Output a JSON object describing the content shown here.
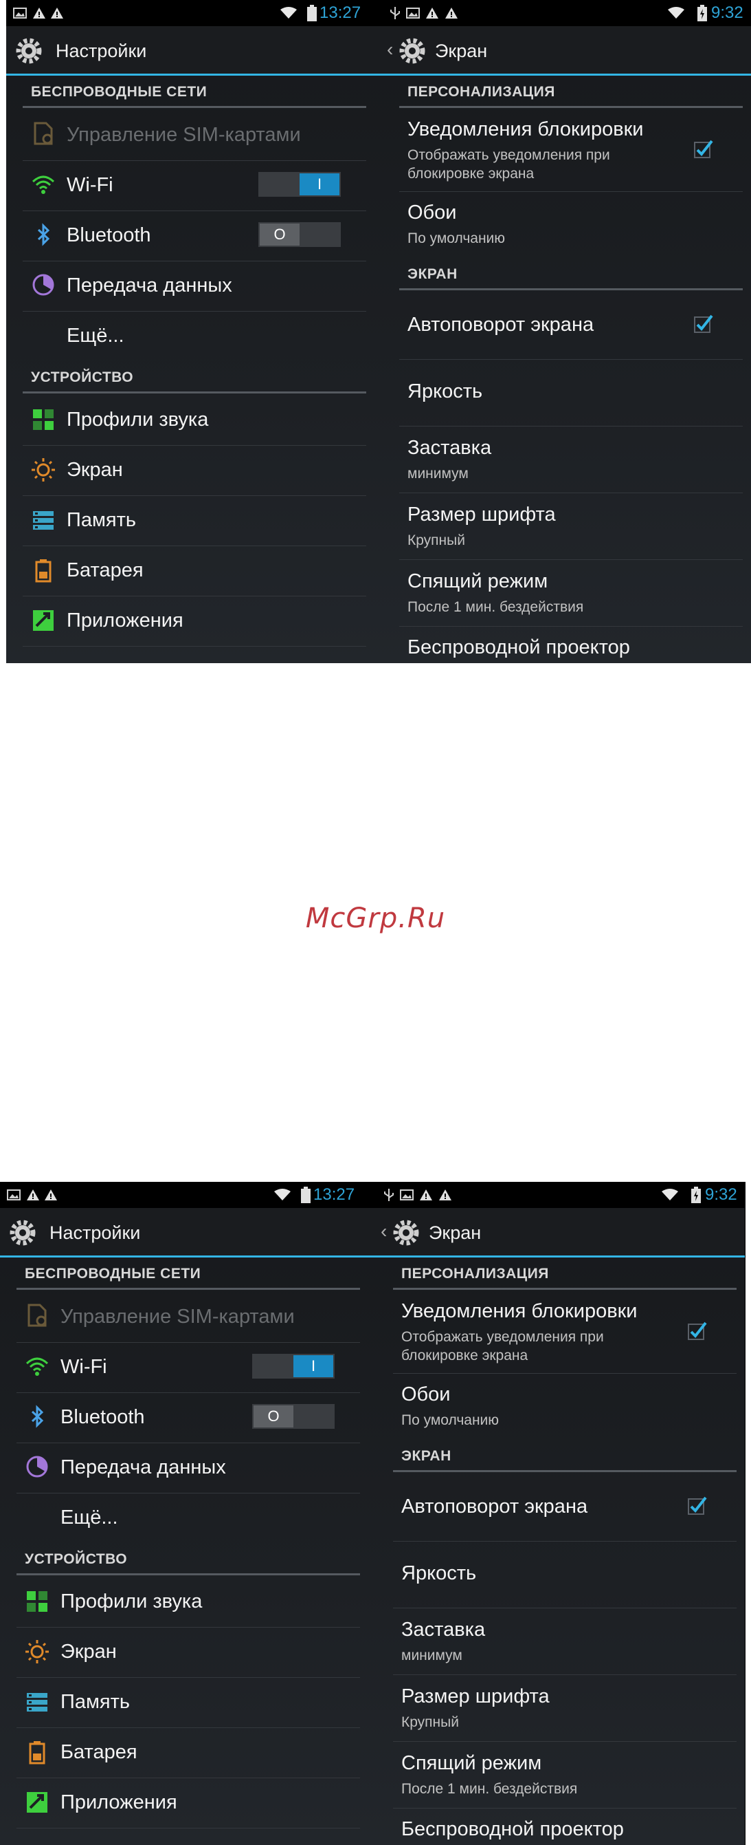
{
  "watermark": "McGrp.Ru",
  "screens": [
    {
      "left": {
        "time": "13:27",
        "title": "Настройки",
        "section_wireless": "БЕСПРОВОДНЫЕ СЕТИ",
        "sim": "Управление SIM-картами",
        "wifi": "Wi-Fi",
        "bluetooth": "Bluetooth",
        "data": "Передача данных",
        "more": "Ещё...",
        "section_device": "УСТРОЙСТВО",
        "sound": "Профили звука",
        "display": "Экран",
        "storage": "Память",
        "battery": "Батарея",
        "apps": "Приложения",
        "toggle_on_glyph": "I",
        "toggle_off_glyph": "O"
      },
      "right": {
        "time": "9:32",
        "title": "Экран",
        "section_personal": "ПЕРСОНАЛИЗАЦИЯ",
        "lock_title": "Уведомления блокировки",
        "lock_sub1": "Отображать уведомления при",
        "lock_sub2": "блокировке экрана",
        "wallpaper": "Обои",
        "wallpaper_sub": "По умолчанию",
        "section_screen": "ЭКРАН",
        "autorotate": "Автоповорот экрана",
        "brightness": "Яркость",
        "daydream": "Заставка",
        "daydream_sub": "минимум",
        "fontsize": "Размер шрифта",
        "fontsize_sub": "Крупный",
        "sleep": "Спящий режим",
        "sleep_sub": "После 1 мин. бездействия",
        "wireless_display": "Беспроводной проектор"
      }
    },
    {
      "left": {
        "time": "13:27",
        "title": "Настройки",
        "section_wireless": "БЕСПРОВОДНЫЕ СЕТИ",
        "sim": "Управление SIM-картами",
        "wifi": "Wi-Fi",
        "bluetooth": "Bluetooth",
        "data": "Передача данных",
        "more": "Ещё...",
        "section_device": "УСТРОЙСТВО",
        "sound": "Профили звука",
        "display": "Экран",
        "storage": "Память",
        "battery": "Батарея",
        "apps": "Приложения",
        "toggle_on_glyph": "I",
        "toggle_off_glyph": "O"
      },
      "right": {
        "time": "9:32",
        "title": "Экран",
        "section_personal": "ПЕРСОНАЛИЗАЦИЯ",
        "lock_title": "Уведомления блокировки",
        "lock_sub1": "Отображать уведомления при",
        "lock_sub2": "блокировке экрана",
        "wallpaper": "Обои",
        "wallpaper_sub": "По умолчанию",
        "section_screen": "ЭКРАН",
        "autorotate": "Автоповорот экрана",
        "brightness": "Яркость",
        "daydream": "Заставка",
        "daydream_sub": "минимум",
        "fontsize": "Размер шрифта",
        "fontsize_sub": "Крупный",
        "sleep": "Спящий режим",
        "sleep_sub": "После 1 мин. бездействия",
        "wireless_display": "Беспроводной проектор"
      }
    }
  ],
  "states": {
    "wifi_enabled": true,
    "bluetooth_enabled": false,
    "lock_notifications_checked": true,
    "autorotate_checked": true
  },
  "colors": {
    "accent": "#33b5e5",
    "toggle_on": "#1a8ac4",
    "watermark": "#c0393f"
  }
}
